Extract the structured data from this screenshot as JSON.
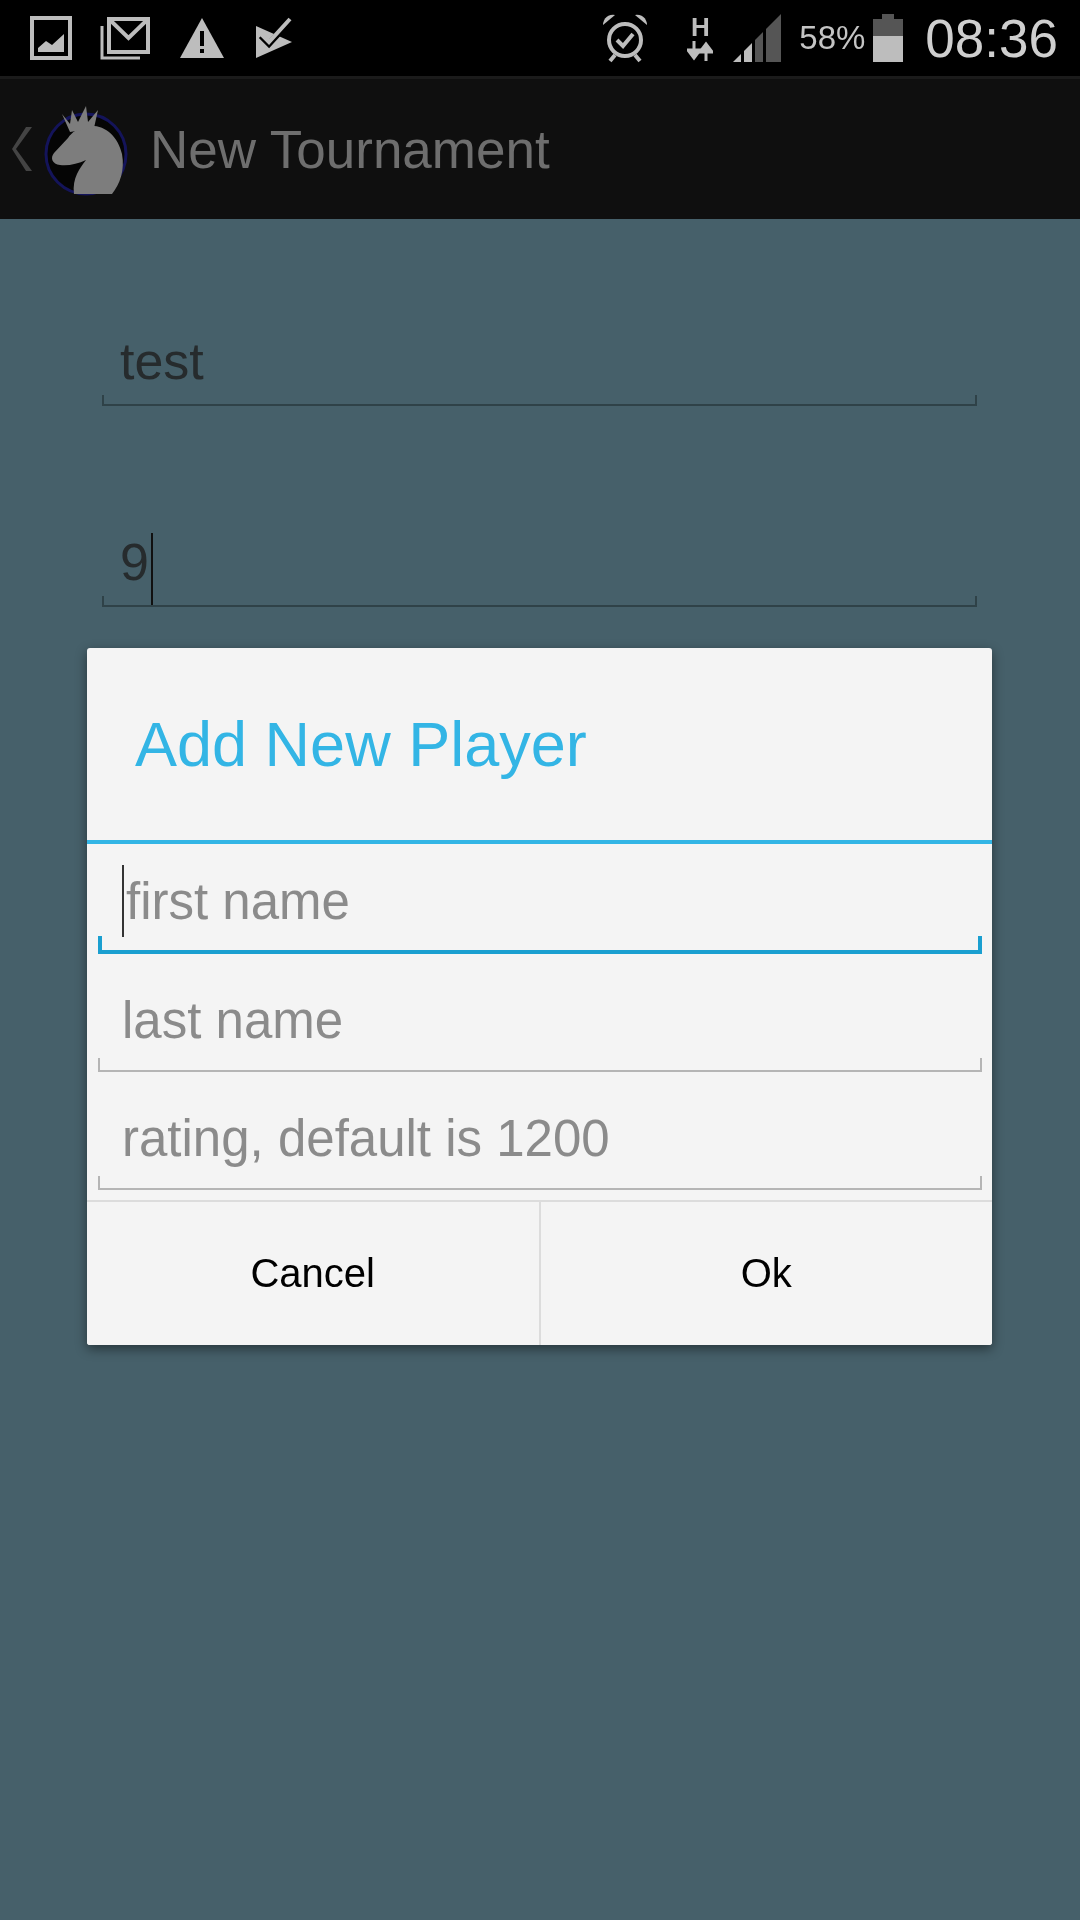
{
  "status_bar": {
    "network_type": "H",
    "battery": "58%",
    "time": "08:36"
  },
  "action_bar": {
    "title": "New Tournament"
  },
  "form": {
    "fields": [
      {
        "value": "test",
        "focused": false
      },
      {
        "value": "9",
        "focused": true
      }
    ]
  },
  "dialog": {
    "title": "Add New Player",
    "fields": [
      {
        "placeholder": "first name",
        "focused": true
      },
      {
        "placeholder": "last name",
        "focused": false
      },
      {
        "placeholder": "rating, default is 1200",
        "focused": false
      }
    ],
    "buttons": [
      {
        "label": "Cancel"
      },
      {
        "label": "Ok"
      }
    ]
  }
}
